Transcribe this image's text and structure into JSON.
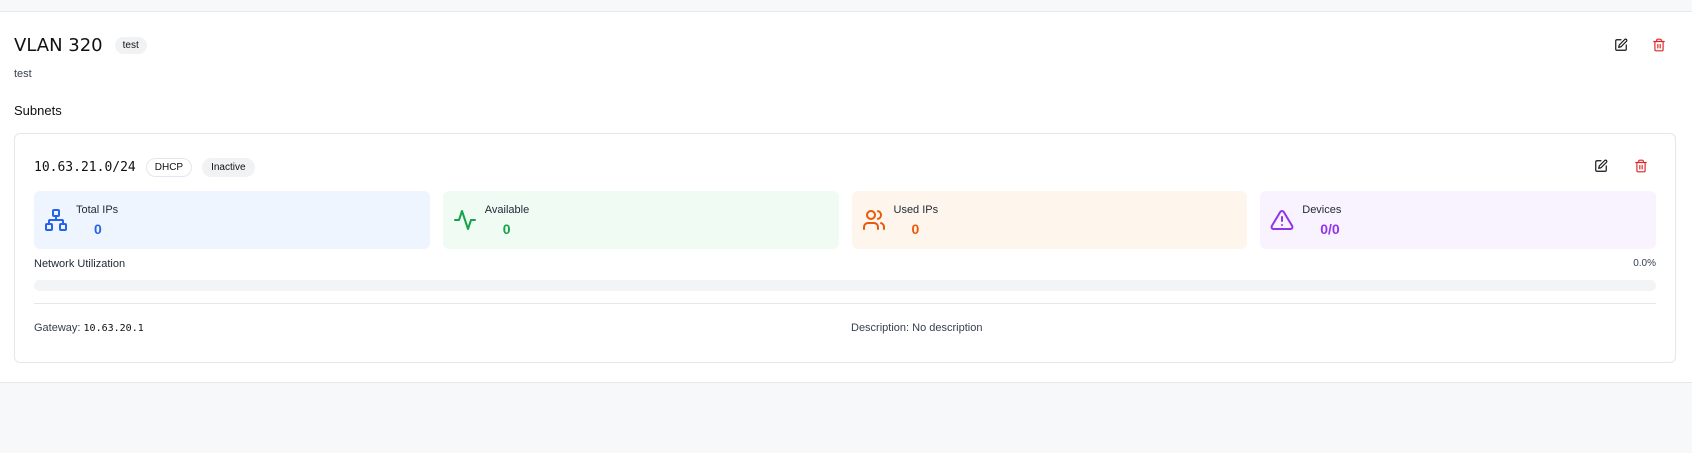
{
  "vlan": {
    "title": "VLAN 320",
    "tag": "test",
    "description": "test"
  },
  "subnets_section": {
    "title": "Subnets"
  },
  "subnet": {
    "cidr": "10.63.21.0/24",
    "badges": [
      "DHCP",
      "Inactive"
    ],
    "stats": [
      {
        "label": "Total IPs",
        "value": "0",
        "icon": "network-icon"
      },
      {
        "label": "Available",
        "value": "0",
        "icon": "activity-icon"
      },
      {
        "label": "Used IPs",
        "value": "0",
        "icon": "users-icon"
      },
      {
        "label": "Devices",
        "value": "0/0",
        "icon": "alert-triangle-icon"
      }
    ],
    "utilization": {
      "label": "Network Utilization",
      "percent_text": "0.0%",
      "percent": 0
    },
    "gateway": {
      "label": "Gateway:",
      "value": "10.63.20.1"
    },
    "description": {
      "label": "Description:",
      "value": "No description"
    }
  },
  "colors": {
    "blue": "#2563eb",
    "green": "#16a34a",
    "orange": "#ea580c",
    "purple": "#9333ea",
    "danger": "#dc2626"
  }
}
